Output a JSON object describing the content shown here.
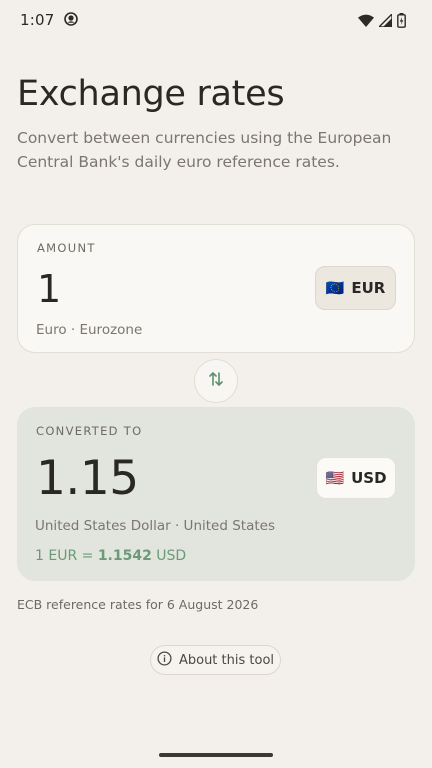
{
  "status_bar": {
    "time": "1:07",
    "icons": [
      "app-notification-icon",
      "wifi-icon",
      "cellular-signal-icon",
      "battery-icon"
    ]
  },
  "header": {
    "title": "Exchange rates",
    "subtitle": "Convert between currencies using the European Central Bank's daily euro reference rates."
  },
  "from_card": {
    "label": "AMOUNT",
    "amount": "1",
    "currency_code": "EUR",
    "flag": "🇪🇺",
    "description": "Euro · Eurozone"
  },
  "to_card": {
    "label": "CONVERTED TO",
    "amount": "1.15",
    "currency_code": "USD",
    "flag": "🇺🇸",
    "description": "United States Dollar · United States",
    "rate": {
      "prefix": "1 EUR = ",
      "value": "1.1542",
      "suffix": " USD"
    }
  },
  "footnote": "ECB reference rates for 6 August 2026",
  "about_button": {
    "label": "About this tool"
  },
  "colors": {
    "background": "#f3f0eb",
    "to_card": "#e2e5dd",
    "accent_green": "#6a9a78"
  }
}
